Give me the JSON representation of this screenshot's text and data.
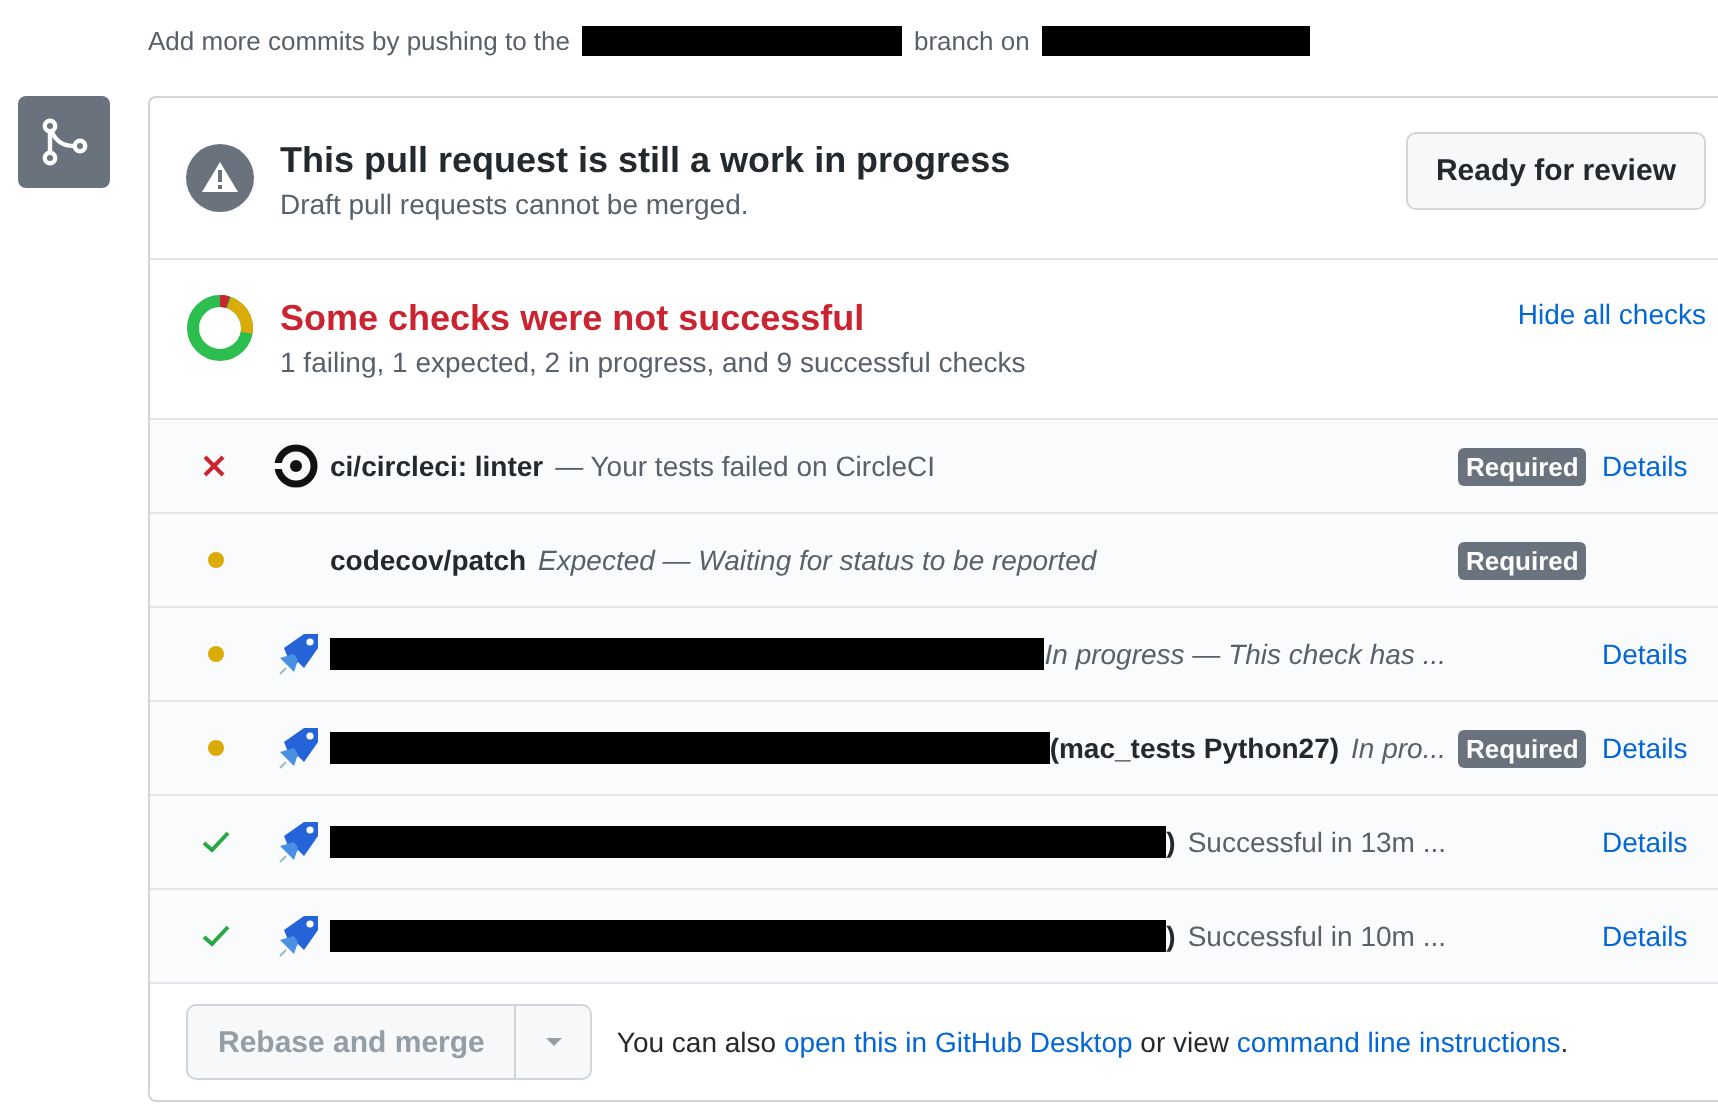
{
  "intro": {
    "before": "Add more commits by pushing to the",
    "middle": "branch on"
  },
  "draft": {
    "title": "This pull request is still a work in progress",
    "subtitle": "Draft pull requests cannot be merged.",
    "button": "Ready for review"
  },
  "checks_summary": {
    "title": "Some checks were not successful",
    "subtitle": "1 failing, 1 expected, 2 in progress, and 9 successful checks",
    "toggle": "Hide all checks"
  },
  "checks": [
    {
      "kind": "failure",
      "name": "ci/circleci: linter",
      "description": "— Your tests failed on CircleCI",
      "badge": "Required",
      "details": "Details"
    },
    {
      "kind": "expected",
      "name": "codecov/patch",
      "description": "Expected — Waiting for status to be reported",
      "badge": "Required"
    },
    {
      "kind": "pending",
      "description": "In progress — This check has ...",
      "details": "Details"
    },
    {
      "kind": "pending",
      "name": "(mac_tests Python27)",
      "description": "In pro...",
      "badge": "Required",
      "details": "Details"
    },
    {
      "kind": "success",
      "name": ")",
      "description": "Successful in 13m ...",
      "details": "Details"
    },
    {
      "kind": "success",
      "name": ")",
      "description": "Successful in 10m ...",
      "details": "Details"
    }
  ],
  "merge": {
    "button": "Rebase and merge",
    "disabled": true,
    "note_before": "You can also",
    "link1": "open this in GitHub Desktop",
    "note_middle": "or view",
    "link2": "command line instructions",
    "note_end": "."
  }
}
